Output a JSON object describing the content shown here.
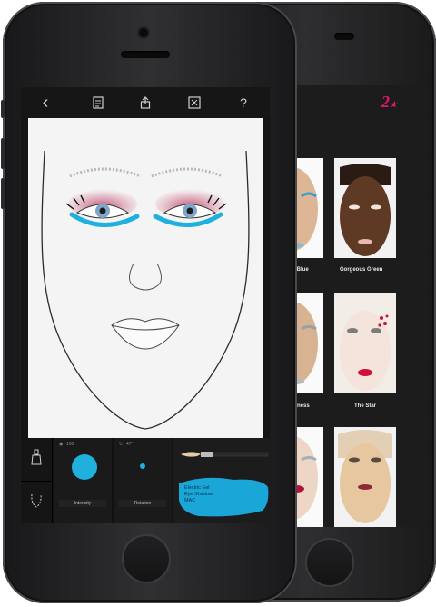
{
  "toolbar": {
    "icons": [
      "back-chevron-icon",
      "notes-icon",
      "share-icon",
      "fullscreen-icon",
      "help-icon"
    ],
    "back_glyph": "‹",
    "help_glyph": "?"
  },
  "badge": {
    "text": "2",
    "color": "#e0186b"
  },
  "looks": [
    {
      "label": "old Blue"
    },
    {
      "label": "Gorgeous Green"
    },
    {
      "label": "ightness"
    },
    {
      "label": "The Star"
    },
    {
      "label": ""
    },
    {
      "label": ""
    }
  ],
  "controls": {
    "intensity": {
      "value": "100",
      "label": "Intensity",
      "level": 1.0
    },
    "rotation": {
      "value": "47°",
      "label": "Rotation"
    }
  },
  "product": {
    "name": "Electric Eel",
    "type": "Eye Shadow",
    "brand": "MAC",
    "swatch_color": "#1aa7d8"
  },
  "colors": {
    "eyeshadow_pink": "#c9607f",
    "eyeliner_blue": "#1fb0de",
    "lip_red": "#d0103a"
  }
}
